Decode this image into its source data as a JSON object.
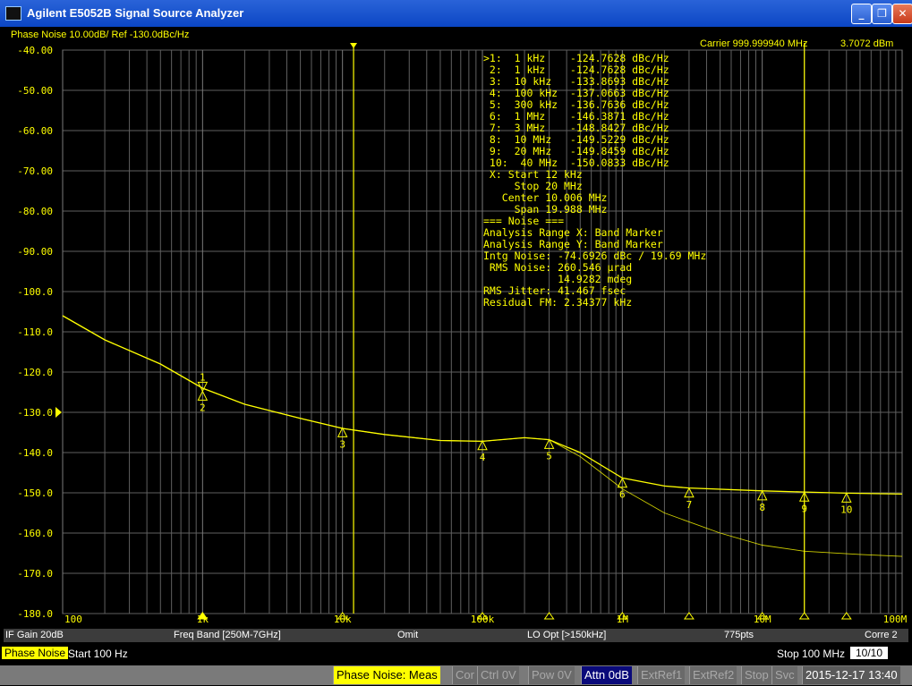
{
  "window": {
    "title": "Agilent E5052B Signal Source Analyzer",
    "min": "_",
    "max": "❐",
    "close": "✕"
  },
  "header": {
    "trace_title": "Phase Noise 10.00dB/ Ref -130.0dBc/Hz",
    "carrier": "Carrier 999.999940 MHz",
    "carrier_power": "3.7072 dBm"
  },
  "colors": {
    "trace": "#ffff00",
    "grid": "#606060",
    "background": "#000000"
  },
  "chart_data": {
    "type": "line",
    "x_scale": "log",
    "xlim": [
      100,
      100000000
    ],
    "ylim": [
      -180,
      -40
    ],
    "y_ref": -130,
    "y_ticks": [
      "-40.00",
      "-50.00",
      "-60.00",
      "-70.00",
      "-80.00",
      "-90.00",
      "-100.0",
      "-110.0",
      "-120.0",
      "-130.0",
      "-140.0",
      "-150.0",
      "-160.0",
      "-170.0",
      "-180.0"
    ],
    "x_ticks": [
      "100",
      "1k",
      "10k",
      "100k",
      "1M",
      "10M",
      "100M"
    ],
    "band_start_hz": 12000,
    "band_stop_hz": 20000000,
    "series": [
      {
        "points": [
          [
            100,
            -106
          ],
          [
            200,
            -112
          ],
          [
            500,
            -118
          ],
          [
            1000,
            -124
          ],
          [
            2000,
            -128
          ],
          [
            5000,
            -131.5
          ],
          [
            10000,
            -134
          ],
          [
            20000,
            -135.5
          ],
          [
            50000,
            -137
          ],
          [
            100000,
            -137.2
          ],
          [
            200000,
            -136.3
          ],
          [
            300000,
            -136.8
          ],
          [
            500000,
            -140
          ],
          [
            1000000,
            -146.3
          ],
          [
            2000000,
            -148.3
          ],
          [
            3000000,
            -148.8
          ],
          [
            10000000,
            -149.5
          ],
          [
            20000000,
            -149.8
          ],
          [
            40000000,
            -150.1
          ],
          [
            100000000,
            -150.3
          ]
        ]
      },
      {
        "points": [
          [
            100,
            -106
          ],
          [
            200,
            -112
          ],
          [
            500,
            -118
          ],
          [
            1000,
            -124
          ],
          [
            2000,
            -128
          ],
          [
            5000,
            -131.5
          ],
          [
            10000,
            -134
          ],
          [
            20000,
            -135.5
          ],
          [
            50000,
            -137
          ],
          [
            100000,
            -137.2
          ],
          [
            200000,
            -136.3
          ],
          [
            300000,
            -136.8
          ],
          [
            500000,
            -141
          ],
          [
            1000000,
            -149
          ],
          [
            2000000,
            -155
          ],
          [
            5000000,
            -160
          ],
          [
            10000000,
            -163
          ],
          [
            20000000,
            -164.5
          ],
          [
            50000000,
            -165.3
          ],
          [
            100000000,
            -165.8
          ]
        ]
      }
    ],
    "markers": [
      {
        "n": "1",
        "hz": 1000,
        "dbc": -124.7628
      },
      {
        "n": "2",
        "hz": 1000,
        "dbc": -124.7628
      },
      {
        "n": "3",
        "hz": 10000,
        "dbc": -133.8693
      },
      {
        "n": "4",
        "hz": 100000,
        "dbc": -137.0663
      },
      {
        "n": "5",
        "hz": 300000,
        "dbc": -136.7636
      },
      {
        "n": "6",
        "hz": 1000000,
        "dbc": -146.3871
      },
      {
        "n": "7",
        "hz": 3000000,
        "dbc": -148.8427
      },
      {
        "n": "8",
        "hz": 10000000,
        "dbc": -149.5229
      },
      {
        "n": "9",
        "hz": 20000000,
        "dbc": -149.8459
      },
      {
        "n": "10",
        "hz": 40000000,
        "dbc": -150.0833
      }
    ],
    "readout": [
      ">1:  1 kHz    -124.7628 dBc/Hz",
      " 2:  1 kHz    -124.7628 dBc/Hz",
      " 3:  10 kHz   -133.8693 dBc/Hz",
      " 4:  100 kHz  -137.0663 dBc/Hz",
      " 5:  300 kHz  -136.7636 dBc/Hz",
      " 6:  1 MHz    -146.3871 dBc/Hz",
      " 7:  3 MHz    -148.8427 dBc/Hz",
      " 8:  10 MHz   -149.5229 dBc/Hz",
      " 9:  20 MHz   -149.8459 dBc/Hz",
      " 10:  40 MHz  -150.0833 dBc/Hz",
      " X: Start 12 kHz",
      "     Stop 20 MHz",
      "   Center 10.006 MHz",
      "     Span 19.988 MHz",
      "=== Noise ===",
      "Analysis Range X: Band Marker",
      "Analysis Range Y: Band Marker",
      "Intg Noise: -74.6926 dBc / 19.69 MHz",
      " RMS Noise: 260.546 µrad",
      "            14.9282 mdeg",
      "RMS Jitter: 41.467 fsec",
      "Residual FM: 2.34377 kHz"
    ]
  },
  "status1": {
    "if_gain": "IF Gain 20dB",
    "freq_band": "Freq Band [250M-7GHz]",
    "omit": "Omit",
    "lo_opt": "LO Opt [>150kHz]",
    "points": "775pts",
    "corre": "Corre 2"
  },
  "status2": {
    "trace": "Phase Noise",
    "start": "Start 100 Hz",
    "stop": "Stop 100 MHz",
    "page": "10/10"
  },
  "status3": {
    "meas": "Phase Noise: Meas",
    "cor": "Cor",
    "ctrl": "Ctrl  0V",
    "pow": "Pow  0V",
    "attn": "Attn 0dB",
    "extref1": "ExtRef1",
    "extref2": "ExtRef2",
    "stop": "Stop",
    "svc": "Svc",
    "datetime": "2015-12-17 13:40"
  }
}
